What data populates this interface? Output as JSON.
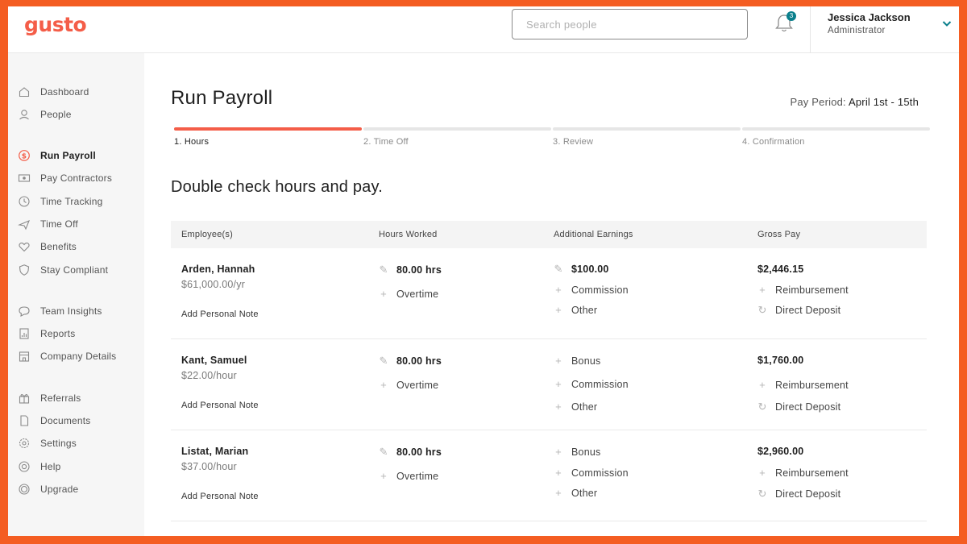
{
  "app": {
    "logo": "gusto"
  },
  "header": {
    "search_placeholder": "Search people",
    "notifications_count": "3",
    "user_name": "Jessica Jackson",
    "user_role": "Administrator"
  },
  "sidebar": {
    "items": [
      {
        "label": "Dashboard",
        "icon": "home-icon"
      },
      {
        "label": "People",
        "icon": "person-icon"
      },
      {
        "label": "Run Payroll",
        "icon": "dollar-icon",
        "active": true
      },
      {
        "label": "Pay Contractors",
        "icon": "cash-icon"
      },
      {
        "label": "Time Tracking",
        "icon": "clock-icon"
      },
      {
        "label": "Time Off",
        "icon": "plane-icon"
      },
      {
        "label": "Benefits",
        "icon": "heart-icon"
      },
      {
        "label": "Stay Compliant",
        "icon": "shield-icon"
      },
      {
        "label": "Team Insights",
        "icon": "chat-icon"
      },
      {
        "label": "Reports",
        "icon": "report-icon"
      },
      {
        "label": "Company Details",
        "icon": "building-icon"
      },
      {
        "label": "Referrals",
        "icon": "gift-icon"
      },
      {
        "label": "Documents",
        "icon": "document-icon"
      },
      {
        "label": "Settings",
        "icon": "gear-icon"
      },
      {
        "label": "Help",
        "icon": "lifebuoy-icon"
      },
      {
        "label": "Upgrade",
        "icon": "upgrade-icon"
      }
    ]
  },
  "main": {
    "title": "Run Payroll",
    "pay_period_label": "Pay Period:",
    "pay_period_value": "April 1st - 15th",
    "steps": [
      "1. Hours",
      "2. Time Off",
      "3. Review",
      "4. Confirmation"
    ],
    "section_title": "Double check hours and pay.",
    "columns": [
      "Employee(s)",
      "Hours Worked",
      "Additional Earnings",
      "Gross Pay"
    ],
    "rows": [
      {
        "name": "Arden, Hannah",
        "rate": "$61,000.00/yr",
        "note": "Add Personal Note",
        "hours": "80.00 hrs",
        "overtime": "Overtime",
        "earn1": "$100.00",
        "earn2": "Commission",
        "earn3": "Other",
        "gross": "$2,446.15",
        "reimb": "Reimbursement",
        "deposit": "Direct Deposit"
      },
      {
        "name": "Kant, Samuel",
        "rate": "$22.00/hour",
        "note": "Add Personal Note",
        "hours": "80.00 hrs",
        "overtime": "Overtime",
        "earn1": "Bonus",
        "earn2": "Commission",
        "earn3": "Other",
        "gross": "$1,760.00",
        "reimb": "Reimbursement",
        "deposit": "Direct Deposit"
      },
      {
        "name": "Listat, Marian",
        "rate": "$37.00/hour",
        "note": "Add Personal Note",
        "hours": "80.00 hrs",
        "overtime": "Overtime",
        "earn1": "Bonus",
        "earn2": "Commission",
        "earn3": "Other",
        "gross": "$2,960.00",
        "reimb": "Reimbursement",
        "deposit": "Direct Deposit"
      }
    ]
  },
  "colors": {
    "brand": "#f45d48",
    "frame": "#f45d22",
    "badge": "#0a7f8c"
  }
}
